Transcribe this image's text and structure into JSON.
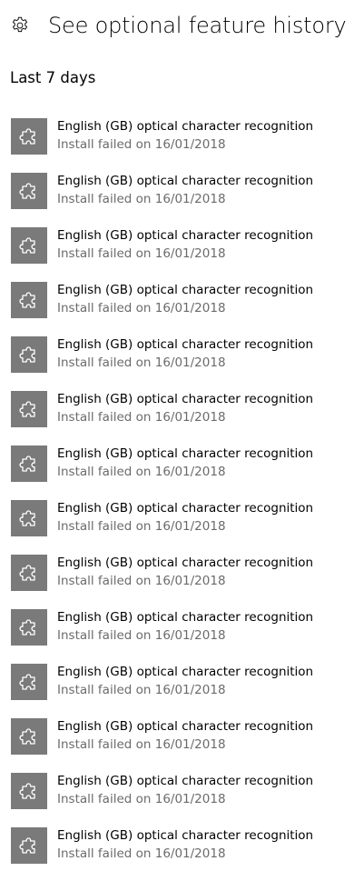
{
  "header": {
    "icon": "gear-icon",
    "title": "See optional feature history"
  },
  "section": {
    "title": "Last 7 days"
  },
  "colors": {
    "tile_background": "#7a7a7a",
    "status_text": "#6b6b6b"
  },
  "items": [
    {
      "icon": "puzzle-piece-icon",
      "name": "English (GB) optical character recognition",
      "status": "Install failed on 16/01/2018"
    },
    {
      "icon": "puzzle-piece-icon",
      "name": "English (GB) optical character recognition",
      "status": "Install failed on 16/01/2018"
    },
    {
      "icon": "puzzle-piece-icon",
      "name": "English (GB) optical character recognition",
      "status": "Install failed on 16/01/2018"
    },
    {
      "icon": "puzzle-piece-icon",
      "name": "English (GB) optical character recognition",
      "status": "Install failed on 16/01/2018"
    },
    {
      "icon": "puzzle-piece-icon",
      "name": "English (GB) optical character recognition",
      "status": "Install failed on 16/01/2018"
    },
    {
      "icon": "puzzle-piece-icon",
      "name": "English (GB) optical character recognition",
      "status": "Install failed on 16/01/2018"
    },
    {
      "icon": "puzzle-piece-icon",
      "name": "English (GB) optical character recognition",
      "status": "Install failed on 16/01/2018"
    },
    {
      "icon": "puzzle-piece-icon",
      "name": "English (GB) optical character recognition",
      "status": "Install failed on 16/01/2018"
    },
    {
      "icon": "puzzle-piece-icon",
      "name": "English (GB) optical character recognition",
      "status": "Install failed on 16/01/2018"
    },
    {
      "icon": "puzzle-piece-icon",
      "name": "English (GB) optical character recognition",
      "status": "Install failed on 16/01/2018"
    },
    {
      "icon": "puzzle-piece-icon",
      "name": "English (GB) optical character recognition",
      "status": "Install failed on 16/01/2018"
    },
    {
      "icon": "puzzle-piece-icon",
      "name": "English (GB) optical character recognition",
      "status": "Install failed on 16/01/2018"
    },
    {
      "icon": "puzzle-piece-icon",
      "name": "English (GB) optical character recognition",
      "status": "Install failed on 16/01/2018"
    },
    {
      "icon": "puzzle-piece-icon",
      "name": "English (GB) optical character recognition",
      "status": "Install failed on 16/01/2018"
    }
  ]
}
